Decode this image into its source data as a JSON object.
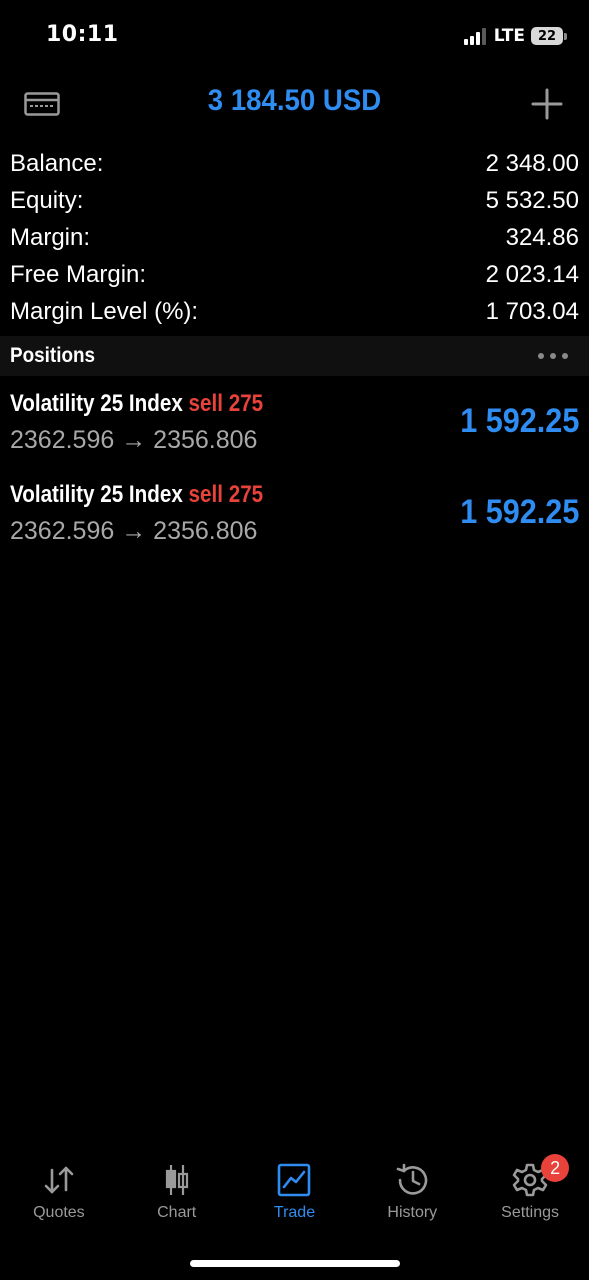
{
  "status_bar": {
    "time": "10:11",
    "network": "LTE",
    "battery": "22"
  },
  "header": {
    "title": "3 184.50 USD",
    "wallet_icon": "wallet-icon",
    "add_icon": "plus-icon"
  },
  "summary": [
    {
      "label": "Balance:",
      "value": "2 348.00"
    },
    {
      "label": "Equity:",
      "value": "5 532.50"
    },
    {
      "label": "Margin:",
      "value": "324.86"
    },
    {
      "label": "Free Margin:",
      "value": "2 023.14"
    },
    {
      "label": "Margin Level (%):",
      "value": "1 703.04"
    }
  ],
  "positions": {
    "title": "Positions",
    "items": [
      {
        "symbol": "Volatility 25 Index",
        "side": "sell 275",
        "prices": "2362.596 → 2356.806",
        "profit": "1 592.25"
      },
      {
        "symbol": "Volatility 25 Index",
        "side": "sell 275",
        "prices": "2362.596 → 2356.806",
        "profit": "1 592.25"
      }
    ]
  },
  "tabs": [
    {
      "label": "Quotes",
      "icon": "quotes-arrows-icon"
    },
    {
      "label": "Chart",
      "icon": "candlestick-icon"
    },
    {
      "label": "Trade",
      "icon": "trade-chart-icon",
      "active": true
    },
    {
      "label": "History",
      "icon": "history-clock-icon"
    },
    {
      "label": "Settings",
      "icon": "gear-icon",
      "badge": "2"
    }
  ],
  "colors": {
    "accent": "#2f8cf1",
    "sell": "#e8423a",
    "background": "#000000",
    "inactive": "#9a9a9a"
  }
}
